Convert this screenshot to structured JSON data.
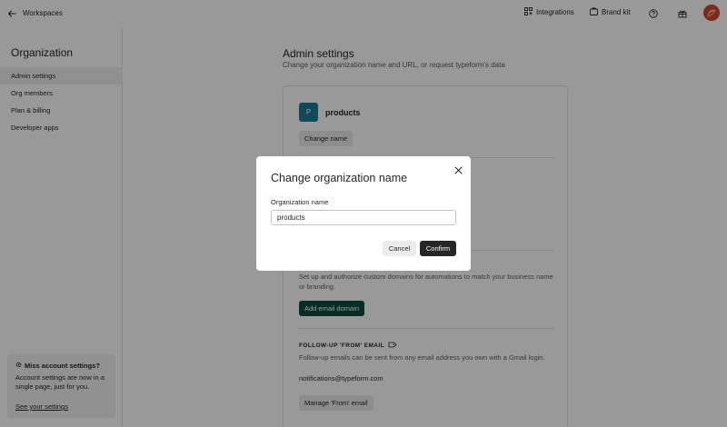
{
  "topbar": {
    "back_label": "Workspaces",
    "integrations_label": "Integrations",
    "brand_kit_label": "Brand kit"
  },
  "sidebar": {
    "title": "Organization",
    "items": [
      {
        "label": "Admin settings",
        "active": true
      },
      {
        "label": "Org members",
        "active": false
      },
      {
        "label": "Plan & billing",
        "active": false
      },
      {
        "label": "Developer apps",
        "active": false
      }
    ],
    "notice": {
      "title": "Miss account settings?",
      "body": "Account settings are now in a single page, just for you.",
      "link": "See your settings"
    }
  },
  "main": {
    "title": "Admin settings",
    "subtitle": "Change your organization name and URL, or request typeform's data",
    "org": {
      "initial": "P",
      "name": "products",
      "change_name_button": "Change name"
    },
    "email_domain": {
      "description": "Set up and authorize custom domains for automations to match your business name or branding.",
      "add_button": "Add email domain"
    },
    "from_email": {
      "label": "FOLLOW-UP 'FROM' EMAIL",
      "description": "Follow-up emails can be sent from any email address you own with a Gmail login.",
      "email": "notifications@typeform.com",
      "manage_button": "Manage 'From' email"
    }
  },
  "modal": {
    "title": "Change organization name",
    "field_label": "Organization name",
    "field_value": "products",
    "cancel_label": "Cancel",
    "confirm_label": "Confirm"
  },
  "colors": {
    "org_avatar": "#1b7a95",
    "primary_dark": "#0d4c3d",
    "user_avatar": "#d2462b",
    "overlay": "rgba(0,0,0,0.4)"
  }
}
